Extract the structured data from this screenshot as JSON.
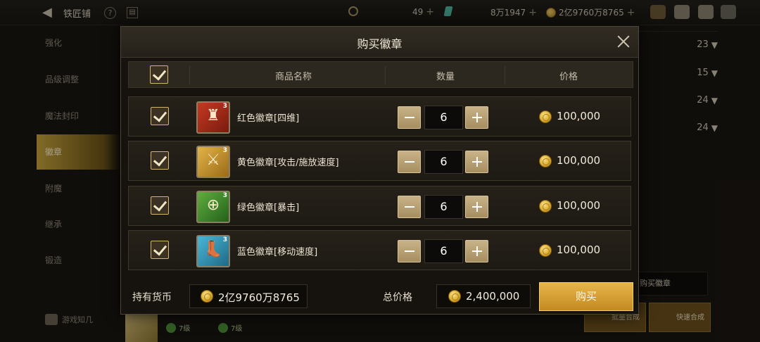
{
  "topbar": {
    "back_icon": "back-arrow-icon",
    "title": "铁匠铺",
    "help_icon": "?",
    "currency1": "49",
    "currency2": "8万1947",
    "currency3": "2亿9760万8765"
  },
  "sidebar": {
    "items": [
      {
        "label": "强化"
      },
      {
        "label": "品级调整"
      },
      {
        "label": "魔法封印"
      },
      {
        "label": "徽章"
      },
      {
        "label": "附魔"
      },
      {
        "label": "继承"
      },
      {
        "label": "锻造"
      }
    ],
    "bottom_label": "游戏知几"
  },
  "background": {
    "counts": [
      "23",
      "15",
      "24",
      "24"
    ],
    "buy_badge_text": "购买徽章",
    "btn_batch": "批量合成",
    "btn_quick": "快速合成",
    "gem_count1": "7级",
    "gem_count2": "7级"
  },
  "modal": {
    "title": "购买徽章",
    "columns": {
      "name": "商品名称",
      "qty": "数量",
      "price": "价格"
    },
    "rows": [
      {
        "name": "红色徽章[四维]",
        "qty": "6",
        "price": "100,000",
        "icon": "red-badge-icon",
        "icon_color": "#b02a1a",
        "tier": "3"
      },
      {
        "name": "黄色徽章[攻击/施放速度]",
        "qty": "6",
        "price": "100,000",
        "icon": "yellow-badge-icon",
        "icon_color": "#d19a2a",
        "tier": "3"
      },
      {
        "name": "绿色徽章[暴击]",
        "qty": "6",
        "price": "100,000",
        "icon": "green-badge-icon",
        "icon_color": "#3f8a2e",
        "tier": "3"
      },
      {
        "name": "蓝色徽章[移动速度]",
        "qty": "6",
        "price": "100,000",
        "icon": "blue-badge-icon",
        "icon_color": "#2d8fb0",
        "tier": "3"
      }
    ],
    "footer": {
      "holding_label": "持有货币",
      "holding_value": "2亿9760万8765",
      "total_label": "总价格",
      "total_value": "2,400,000",
      "buy_label": "购买"
    }
  }
}
